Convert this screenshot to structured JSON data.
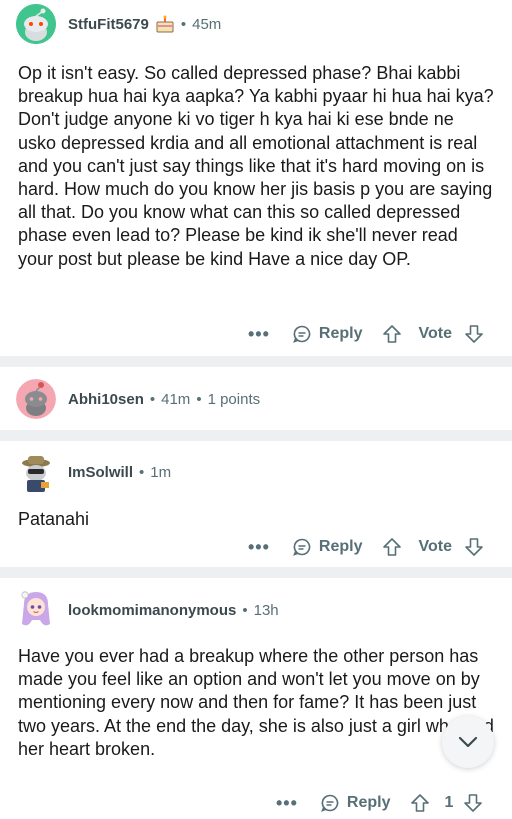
{
  "comments": [
    {
      "username": "StfuFit5679",
      "time": "45m",
      "body": "Op it isn't easy. So called depressed phase? Bhai kabbi breakup hua hai kya aapka? Ya kabhi pyaar hi hua hai kya? Don't judge anyone ki vo tiger h kya hai ki ese bnde ne usko depressed krdia and all emotional attachment is real and you can't just say things like that it's hard moving on is hard. How much do you know her jis basis p you are saying all that. Do you know what can this so called depressed phase even lead to? Please be kind ik she'll never read your post but please be kind Have a nice day OP.",
      "more": "•••",
      "reply": "Reply",
      "vote": "Vote",
      "avatar_color": "#3fbf8a",
      "flair_icon": "cake-icon"
    },
    {
      "username": "Abhi10sen",
      "time": "41m",
      "points": "1 points",
      "avatar_color": "#f4a7b0"
    },
    {
      "username": "ImSolwill",
      "time": "1m",
      "body": "Patanahi",
      "more": "•••",
      "reply": "Reply",
      "vote": "Vote"
    },
    {
      "username": "lookmomimanonymous",
      "time": "13h",
      "body": "Have you ever had a breakup where the other person has made you feel like an option and won't let you move on by mentioning every now and then for fame? It has been just two years. At the end the day, she is also just a girl who had her heart broken.",
      "more": "•••",
      "reply": "Reply",
      "vote": "1"
    }
  ],
  "scroll_button_icon": "chevron-down-icon",
  "separator_color": "#edeff1"
}
